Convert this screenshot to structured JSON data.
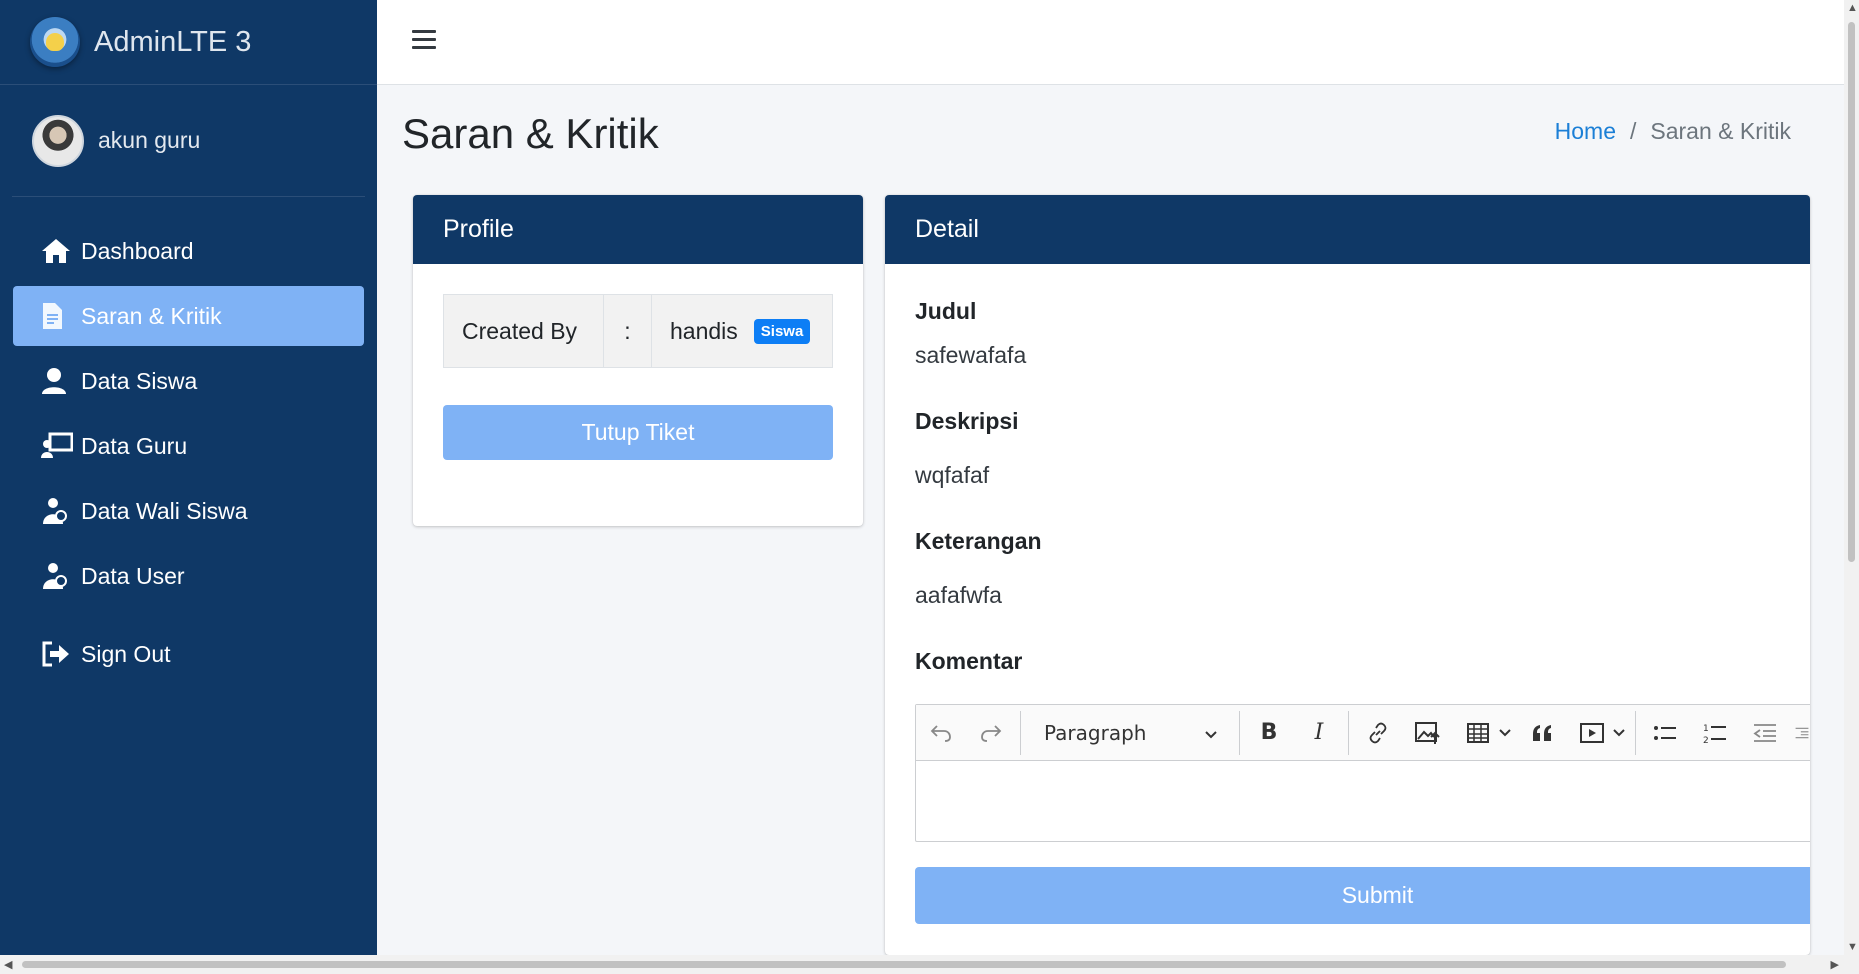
{
  "brand": {
    "name": "AdminLTE 3"
  },
  "user": {
    "name": "akun guru"
  },
  "sidebar": {
    "items": [
      {
        "label": "Dashboard",
        "icon": "home-icon"
      },
      {
        "label": "Saran & Kritik",
        "icon": "file-text-icon",
        "active": true
      },
      {
        "label": "Data Siswa",
        "icon": "user-icon"
      },
      {
        "label": "Data Guru",
        "icon": "chalkboard-teacher-icon"
      },
      {
        "label": "Data Wali Siswa",
        "icon": "parent-child-icon"
      },
      {
        "label": "Data User",
        "icon": "parent-child-icon"
      },
      {
        "label": "Sign Out",
        "icon": "sign-out-icon"
      }
    ]
  },
  "header": {
    "title": "Saran & Kritik",
    "breadcrumb": {
      "home": "Home",
      "separator": "/",
      "current": "Saran & Kritik"
    }
  },
  "profile": {
    "title": "Profile",
    "created_by_label": "Created By",
    "colon": ":",
    "created_by_value": "handis",
    "role_badge": "Siswa",
    "close_button": "Tutup Tiket"
  },
  "detail": {
    "title": "Detail",
    "judul_label": "Judul",
    "judul_value": "safewafafa",
    "deskripsi_label": "Deskripsi",
    "deskripsi_value": "wqfafaf",
    "keterangan_label": "Keterangan",
    "keterangan_value": "aafafwfa",
    "komentar_label": "Komentar",
    "editor": {
      "paragraph_select": "Paragraph"
    },
    "submit_button": "Submit"
  },
  "colors": {
    "sidebar_bg": "#0f3866",
    "active_item": "#7fb2f5",
    "badge": "#0d7ef5",
    "link": "#1b7fd6"
  }
}
